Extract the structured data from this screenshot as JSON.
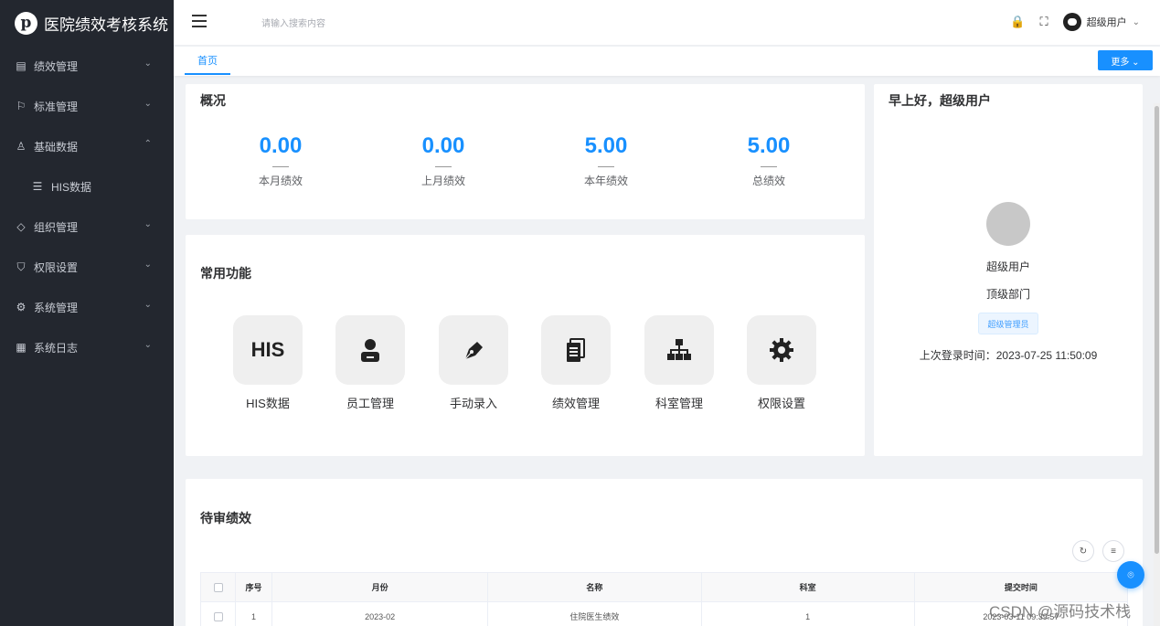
{
  "app": {
    "title": "医院绩效考核系统",
    "logo_icon": "pinterest-logo-icon"
  },
  "sidebar": {
    "items": [
      {
        "label": "绩效管理",
        "icon": "document-icon",
        "glyph": "▤",
        "arrow": "⌄"
      },
      {
        "label": "标准管理",
        "icon": "flag-icon",
        "glyph": "⚐",
        "arrow": "⌄"
      },
      {
        "label": "基础数据",
        "icon": "user-icon",
        "glyph": "♙",
        "arrow": "⌃"
      },
      {
        "label": "HIS数据",
        "icon": "list-icon",
        "glyph": "☰"
      },
      {
        "label": "组织管理",
        "icon": "diamond-icon",
        "glyph": "◇",
        "arrow": "⌄"
      },
      {
        "label": "权限设置",
        "icon": "shield-icon",
        "glyph": "⛉",
        "arrow": "⌄"
      },
      {
        "label": "系统管理",
        "icon": "gear-icon",
        "glyph": "⚙",
        "arrow": "⌄"
      },
      {
        "label": "系统日志",
        "icon": "log-icon",
        "glyph": "▦",
        "arrow": "⌄"
      }
    ]
  },
  "header": {
    "search_placeholder": "请输入搜索内容",
    "lock_glyph": "🔒",
    "fullscreen_glyph": "⛶",
    "user_name": "超级用户",
    "caret": "⌄"
  },
  "tabs": {
    "home": "首页",
    "more": "更多 ⌄"
  },
  "overview": {
    "title": "概况",
    "stats": [
      {
        "value": "0.00",
        "label": "本月绩效"
      },
      {
        "value": "0.00",
        "label": "上月绩效"
      },
      {
        "value": "5.00",
        "label": "本年绩效"
      },
      {
        "value": "5.00",
        "label": "总绩效"
      }
    ]
  },
  "functions": {
    "title": "常用功能",
    "items": [
      {
        "label": "HIS数据",
        "icon": "his-icon",
        "box_text": "HIS"
      },
      {
        "label": "员工管理",
        "icon": "employee-icon"
      },
      {
        "label": "手动录入",
        "icon": "pen-icon"
      },
      {
        "label": "绩效管理",
        "icon": "file-icon"
      },
      {
        "label": "科室管理",
        "icon": "org-chart-icon"
      },
      {
        "label": "权限设置",
        "icon": "settings-gear-icon"
      }
    ]
  },
  "user_card": {
    "greeting": "早上好，超级用户",
    "name": "超级用户",
    "dept": "顶级部门",
    "role": "超级管理员",
    "last_login": "上次登录时间：2023-07-25 11:50:09"
  },
  "pending": {
    "title": "待审绩效",
    "refresh_glyph": "↻",
    "columns_glyph": "≡",
    "columns": [
      "序号",
      "月份",
      "名称",
      "科室",
      "提交时间"
    ],
    "rows": [
      [
        "1",
        "2023-02",
        "住院医生绩效",
        "1",
        "2023-03-11 09:39:57"
      ]
    ]
  },
  "float_glyph": "⌾",
  "watermark": "CSDN @源码技术栈"
}
